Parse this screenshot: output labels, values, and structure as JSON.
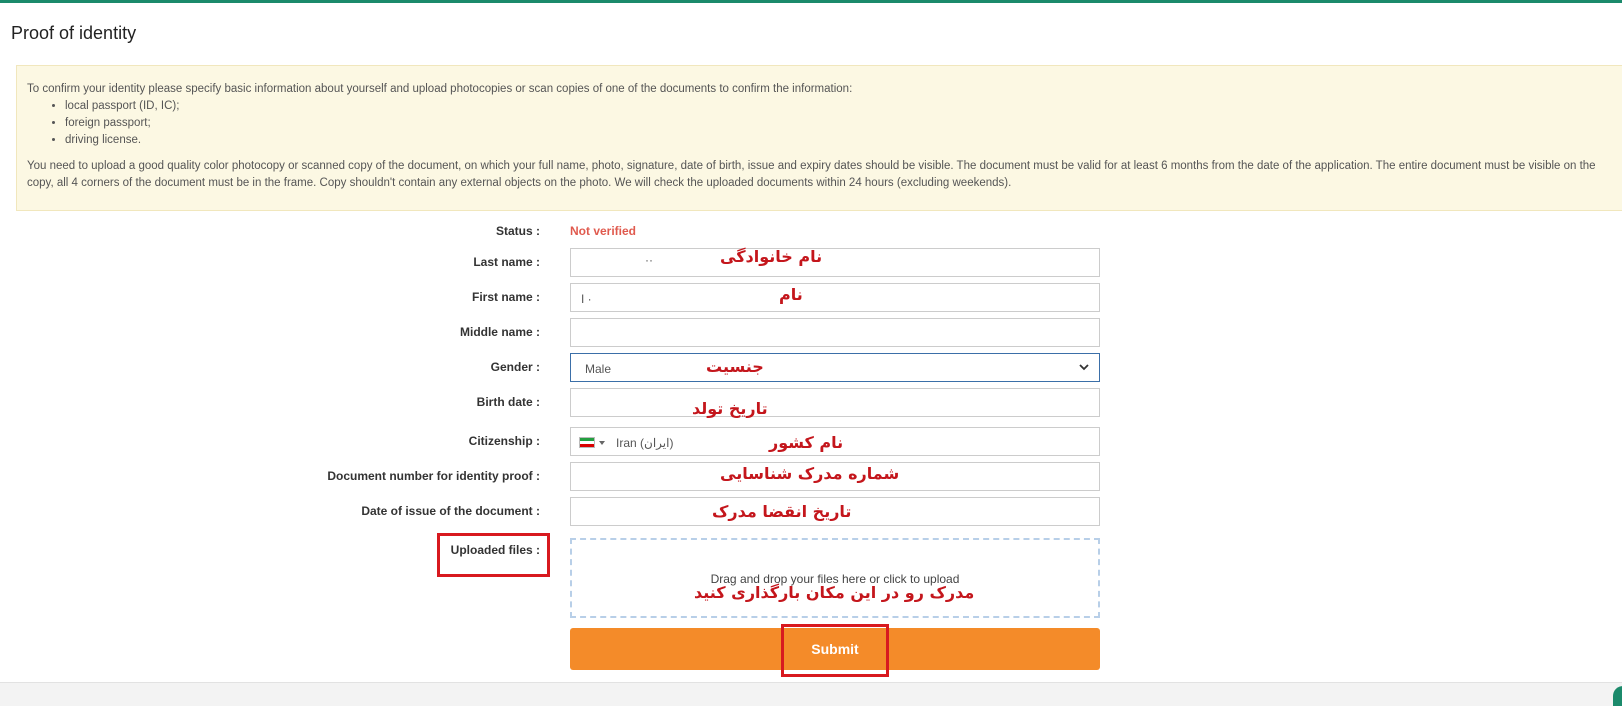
{
  "page": {
    "title": "Proof of identity"
  },
  "notice": {
    "intro": "To confirm your identity please specify basic information about yourself and upload photocopies or scan copies of one of the documents to confirm the information:",
    "documents": [
      "local passport (ID, IC);",
      "foreign passport;",
      "driving license."
    ],
    "body": "You need to upload a good quality color photocopy or scanned copy of the document, on which your full name, photo, signature, date of birth, issue and expiry dates should be visible. The document must be valid for at least 6 months from the date of the application. The entire document must be visible on the copy, all 4 corners of the document must be in the frame. Copy shouldn't contain any external objects on the photo. We will check the uploaded documents within 24 hours (excluding weekends)."
  },
  "form": {
    "status_label": "Status :",
    "status_value": "Not verified",
    "last_name_label": "Last name :",
    "last_name_value": "··",
    "first_name_label": "First name :",
    "first_name_value": "I ·",
    "middle_name_label": "Middle name :",
    "middle_name_value": "",
    "gender_label": "Gender :",
    "gender_value": "Male",
    "birth_date_label": "Birth date :",
    "birth_date_value": "",
    "citizenship_label": "Citizenship :",
    "citizenship_value": "Iran (‫ایران‬‎)",
    "document_number_label": "Document number for identity proof :",
    "document_number_value": "",
    "issue_date_label": "Date of issue of the document :",
    "issue_date_value": "",
    "uploaded_files_label": "Uploaded files :",
    "dropzone_hint": "Drag and drop your files here or click to upload",
    "submit_label": "Submit"
  },
  "annotations": {
    "last_name": "نام خانوادگی",
    "first_name": "نام",
    "gender": "جنسیت",
    "birth_date": "تاریخ تولد",
    "citizenship": "نام کشور",
    "document_number": "شماره مدرک شناسایی",
    "issue_date": "تاریخ انقضا مدرک",
    "upload": "مدرک رو در این مکان بارگذاری کنید"
  },
  "colors": {
    "accent": "#1b8a6b",
    "status_unverified": "#e05a4e",
    "submit": "#f48b29",
    "annotation": "#c4161c",
    "notice_bg": "#fcf8e3"
  },
  "icons": {
    "gender_select": "chevron-down-icon",
    "citizenship": "iran-flag-icon"
  }
}
